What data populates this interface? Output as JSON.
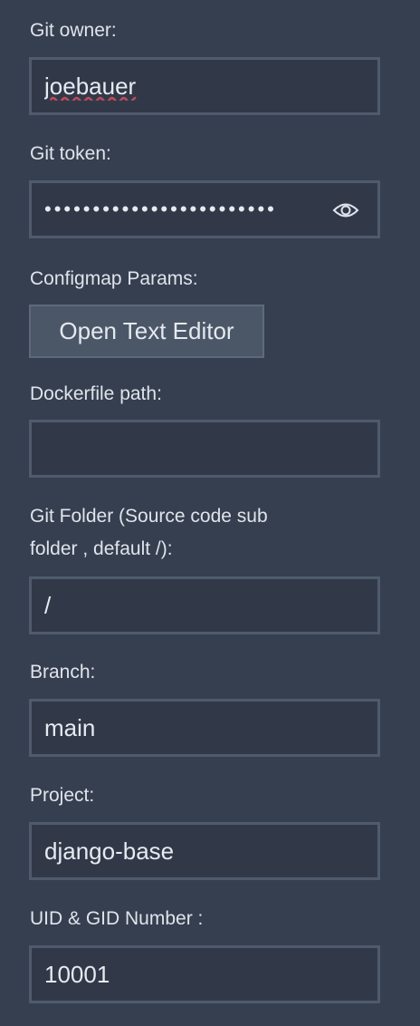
{
  "git_owner": {
    "label": "Git owner:",
    "value": "joebauer"
  },
  "git_token": {
    "label": "Git token:",
    "value": "••••••••••••••••••••••••",
    "icon": "eye-icon"
  },
  "configmap": {
    "label": "Configmap Params:",
    "button_label": "Open Text Editor"
  },
  "dockerfile": {
    "label": "Dockerfile path:",
    "value": ""
  },
  "git_folder": {
    "label_line1": "Git Folder (Source code sub",
    "label_line2": "folder , default /):",
    "value": "/"
  },
  "branch": {
    "label": "Branch:",
    "value": "main"
  },
  "project": {
    "label": "Project:",
    "value": "django-base"
  },
  "uid_gid": {
    "label": "UID & GID Number :",
    "value": "10001"
  }
}
